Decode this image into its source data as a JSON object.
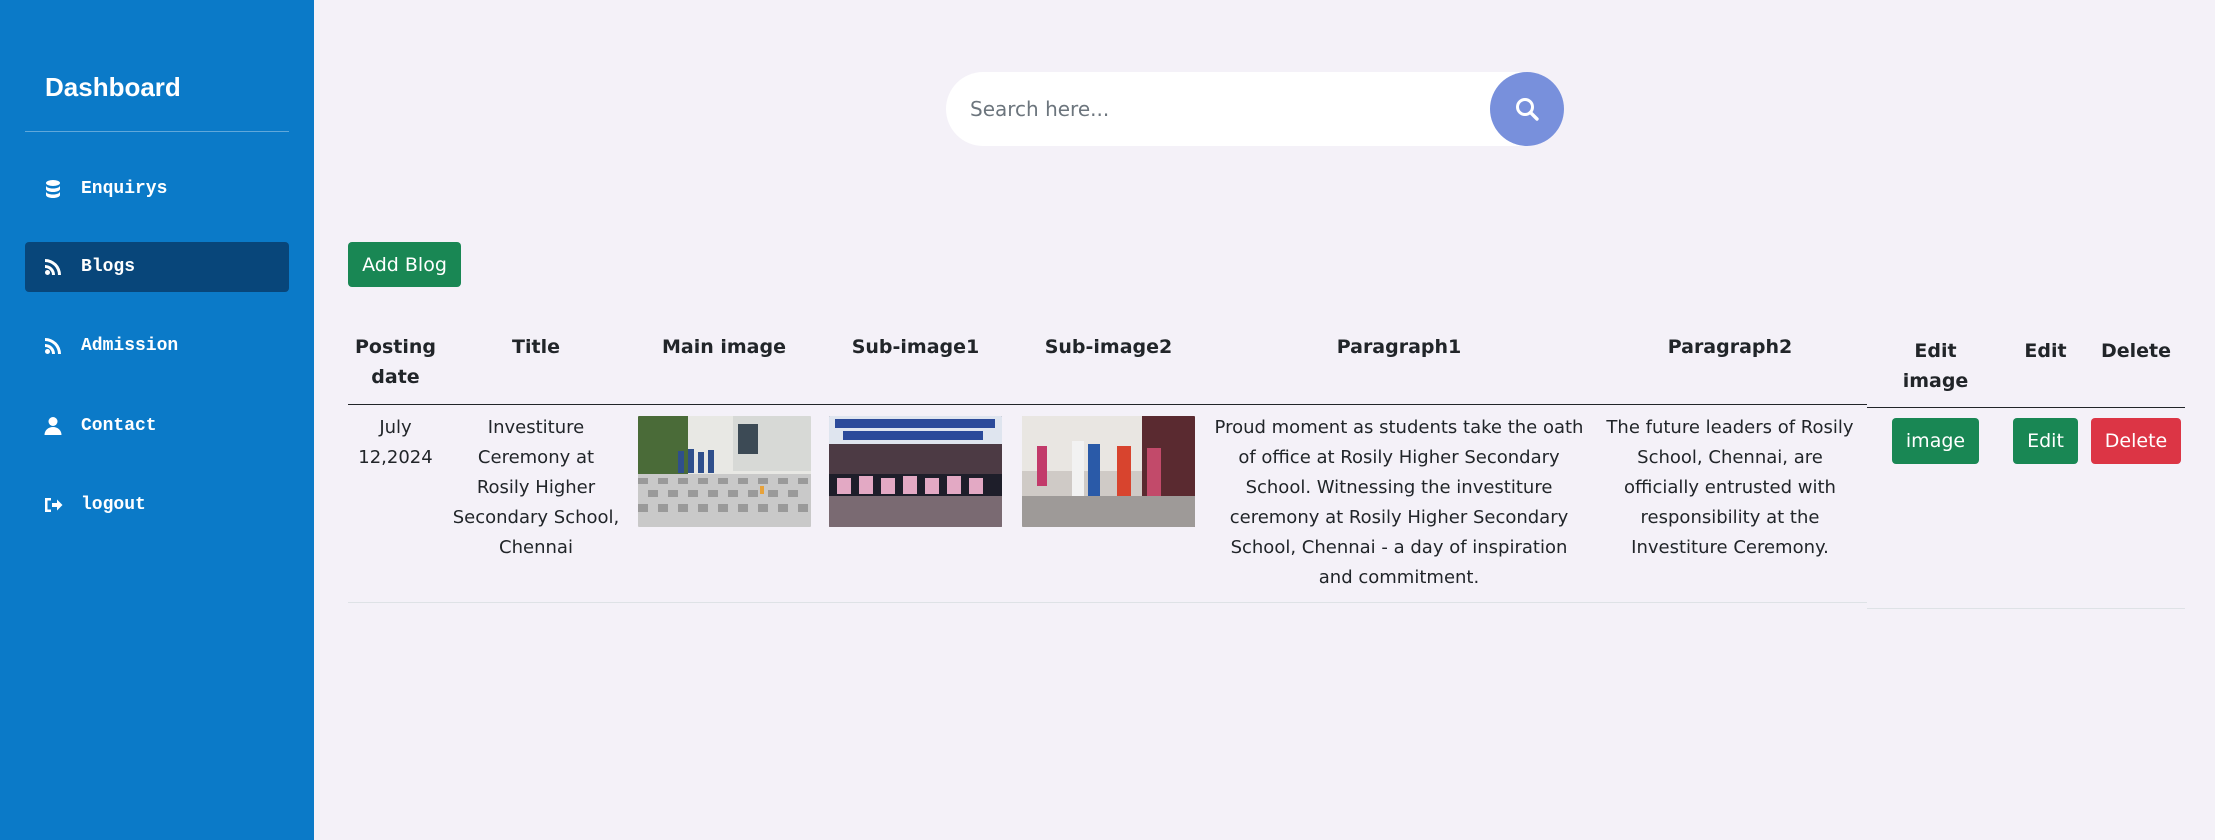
{
  "sidebar": {
    "brand": "Dashboard",
    "items": [
      {
        "label": "Enquirys",
        "icon": "database-icon"
      },
      {
        "label": "Blogs",
        "icon": "blog-icon",
        "active": true
      },
      {
        "label": "Admission",
        "icon": "blog-icon"
      },
      {
        "label": "Contact",
        "icon": "user-icon"
      },
      {
        "label": "logout",
        "icon": "sign-out-icon"
      }
    ]
  },
  "search": {
    "placeholder": "Search here...",
    "value": ""
  },
  "toolbar": {
    "add_label": "Add Blog"
  },
  "table": {
    "headers": [
      "Posting date",
      "Title",
      "Main image",
      "Sub-image1",
      "Sub-image2",
      "Paragraph1",
      "Paragraph2"
    ],
    "action_headers": [
      "Edit image",
      "Edit",
      "Delete"
    ],
    "rows": [
      {
        "date": "July 12,2024",
        "title": "Investiture Ceremony at Rosily Higher Secondary School, Chennai",
        "paragraph1": "Proud moment as students take the oath of office at Rosily Higher Secondary School. Witnessing the investiture ceremony at Rosily Higher Secondary School, Chennai - a day of inspiration and commitment.",
        "paragraph2": "The future leaders of Rosily School, Chennai, are officially entrusted with responsibility at the Investiture Ceremony.",
        "image_label": "image",
        "edit_label": "Edit",
        "delete_label": "Delete"
      }
    ]
  },
  "colors": {
    "sidebar": "#0b7ac8",
    "sidebar_active": "#08467a",
    "background": "#f4f1f8",
    "search_button": "#7890dc",
    "success": "#198754",
    "danger": "#dc3545"
  }
}
